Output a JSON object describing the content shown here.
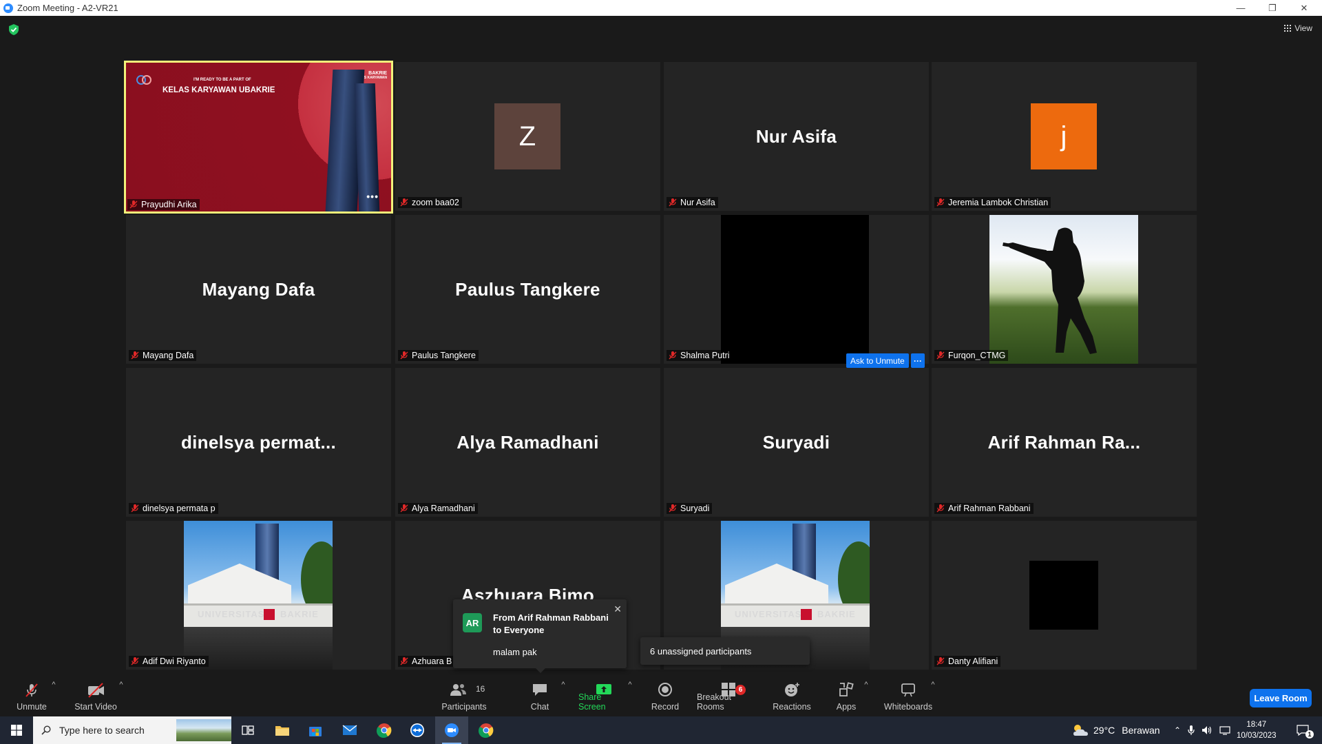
{
  "window": {
    "title": "Zoom Meeting - A2-VR21",
    "minimize": "—",
    "restore": "❐",
    "close": "✕"
  },
  "meeting": {
    "view_label": "View",
    "tiles": [
      {
        "name": "Prayudhi Arika",
        "kind": "banner",
        "active_speaker": true
      },
      {
        "name": "zoom baa02",
        "kind": "avatar",
        "avatar_letter": "Z",
        "avatar_color": "#5d433c"
      },
      {
        "name": "Nur Asifa",
        "kind": "text",
        "display": "Nur Asifa"
      },
      {
        "name": "Jeremia Lambok Christian",
        "kind": "avatar",
        "avatar_letter": "j",
        "avatar_color": "#ed6a0e"
      },
      {
        "name": "Mayang Dafa",
        "kind": "text",
        "display": "Mayang Dafa"
      },
      {
        "name": "Paulus Tangkere",
        "kind": "text",
        "display": "Paulus Tangkere"
      },
      {
        "name": "Shalma Putri",
        "kind": "black"
      },
      {
        "name": "Furqon_CTMG",
        "kind": "photo-soldier"
      },
      {
        "name": "dinelsya permata p",
        "kind": "text",
        "display": "dinelsya  permat..."
      },
      {
        "name": "Alya Ramadhani",
        "kind": "text",
        "display": "Alya Ramadhani"
      },
      {
        "name": "Suryadi",
        "kind": "text",
        "display": "Suryadi"
      },
      {
        "name": "Arif Rahman Rabbani",
        "kind": "text",
        "display": "Arif  Rahman  Ra..."
      },
      {
        "name": "Adif Dwi Riyanto",
        "kind": "photo-campus"
      },
      {
        "name": "Azhuara B",
        "kind": "text",
        "display": "Aszhuara Bimo"
      },
      {
        "name": "",
        "kind": "photo-campus"
      },
      {
        "name": "Danty Alifiani",
        "kind": "black-small"
      }
    ],
    "banner": {
      "small_text": "I'M READY TO BE A PART OF",
      "headline": "KELAS KARYAWAN UBAKRIE",
      "logo_text": "BAKRIE",
      "logo_sub": "KELAS KARYAWAN"
    },
    "more_dots": "•••",
    "ask_to_unmute": "Ask to Unmute",
    "ask_more": "···",
    "campus_sign_left": "UNIVERSITAS",
    "campus_sign_right": "BAKRIE"
  },
  "chat_popup": {
    "avatar_initials": "AR",
    "from": "From Arif Rahman Rabbani to Everyone",
    "message": "malam pak",
    "close": "✕"
  },
  "unassigned_popup": "6 unassigned participants",
  "toolbar": {
    "unmute": "Unmute",
    "start_video": "Start Video",
    "participants": "Participants",
    "participants_count": "16",
    "chat": "Chat",
    "share_screen": "Share Screen",
    "record": "Record",
    "breakout_rooms": "Breakout Rooms",
    "breakout_count": "6",
    "reactions": "Reactions",
    "apps": "Apps",
    "whiteboards": "Whiteboards",
    "leave": "Leave Room",
    "caret": "^"
  },
  "taskbar": {
    "search_placeholder": "Type here to search",
    "weather_temp": "29°C",
    "weather_desc": "Berawan",
    "time": "18:47",
    "date": "10/03/2023",
    "notification_count": "1"
  },
  "colors": {
    "accent": "#0e72ed",
    "active_border": "#f2f27a",
    "mic_off": "#e02828",
    "share_green": "#23d959"
  }
}
